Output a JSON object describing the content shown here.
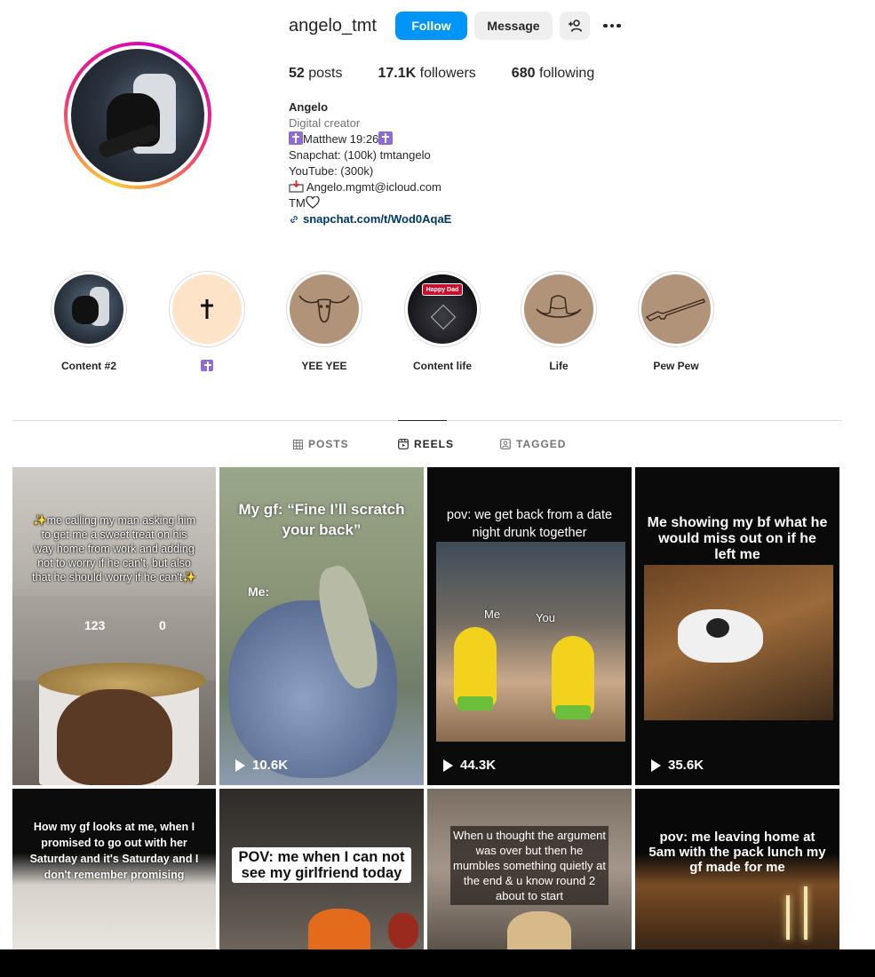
{
  "profile": {
    "username": "angelo_tmt",
    "follow_label": "Follow",
    "message_label": "Message",
    "stats": {
      "posts_count": "52",
      "posts_label": "posts",
      "followers_count": "17.1K",
      "followers_label": "followers",
      "following_count": "680",
      "following_label": "following"
    },
    "bio": {
      "name": "Angelo",
      "category": "Digital creator",
      "line_verse": "Matthew 19:26",
      "line_snapchat": "Snapchat: (100k) tmtangelo",
      "line_youtube": "YouTube: (300k)",
      "line_email": "Angelo.mgmt@icloud.com",
      "line_tm": "TM",
      "link": "snapchat.com/t/Wod0AqaE"
    }
  },
  "highlights": [
    {
      "label": "Content #2"
    },
    {
      "label": ""
    },
    {
      "label": "YEE YEE"
    },
    {
      "label": "Content life",
      "badge": "Happy Dad"
    },
    {
      "label": "Life"
    },
    {
      "label": "Pew Pew"
    }
  ],
  "tabs": {
    "posts": "POSTS",
    "reels": "REELS",
    "tagged": "TAGGED",
    "active": "reels"
  },
  "reels": [
    {
      "caption": "✨me calling my man asking him to get me a sweet treat on his way home from work and adding not to worry if he can't, but also that he should worry if he can't✨",
      "num_left": "123",
      "num_right": "0",
      "views": ""
    },
    {
      "caption": "My gf: “Fine I’ll scratch your back”",
      "sub": "Me:",
      "views": "10.6K"
    },
    {
      "caption": "pov: we get back from a date night drunk together",
      "me": "Me",
      "you": "You",
      "views": "44.3K"
    },
    {
      "caption": "Me showing my bf what he would miss out on if he left me",
      "views": "35.6K"
    },
    {
      "caption": "How my gf looks at me, when I promised to go out with her Saturday and it's Saturday and I don't remember promising",
      "views": ""
    },
    {
      "caption": "POV: me when I can not see my girlfriend today",
      "views": ""
    },
    {
      "caption": "When u thought the argument was over but then he mumbles something quietly at the end & u know round 2 about to start",
      "views": ""
    },
    {
      "caption": "pov: me leaving home at 5am with the pack lunch my gf made for me",
      "views": ""
    }
  ],
  "colors": {
    "follow_blue": "#0095f6",
    "link_blue": "#00376b",
    "muted_gray": "#737373"
  }
}
